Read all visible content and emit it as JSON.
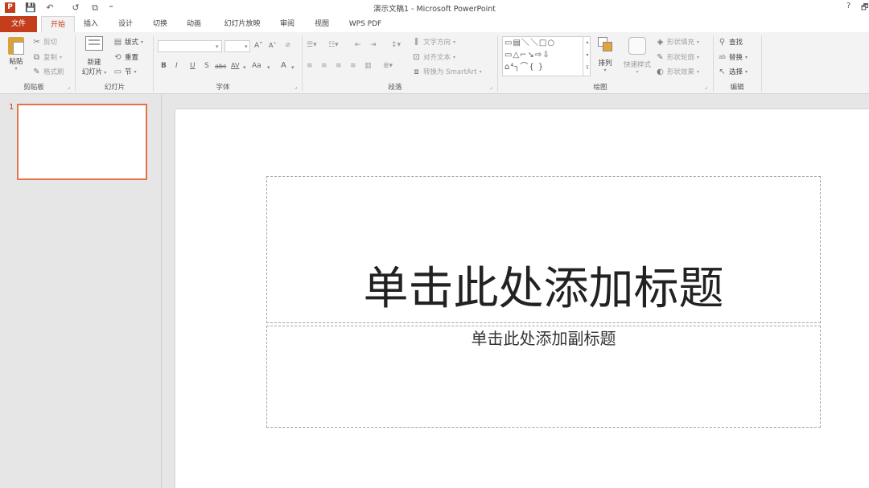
{
  "window": {
    "title": "演示文稿1 - Microsoft PowerPoint",
    "help": "?",
    "restore": "🗗"
  },
  "quick_access": {
    "app_icon": "P",
    "save_icon": "💾",
    "undo_icon": "↶",
    "redo_icon": "↺",
    "present_icon": "⧉",
    "customize_icon": "⁼"
  },
  "tabs": [
    "文件",
    "开始",
    "插入",
    "设计",
    "切换",
    "动画",
    "幻灯片放映",
    "审阅",
    "视图",
    "WPS PDF"
  ],
  "ribbon": {
    "clipboard": {
      "label": "剪贴板",
      "paste": "粘贴",
      "cut": "剪切",
      "copy": "复制",
      "format_painter": "格式刷"
    },
    "slides": {
      "label": "幻灯片",
      "new_slide_line1": "新建",
      "new_slide_line2": "幻灯片",
      "layout": "版式",
      "reset": "重置",
      "section": "节"
    },
    "font": {
      "label": "字体",
      "bold": "B",
      "italic": "I",
      "underline": "U",
      "strike": "S",
      "abc": "abc",
      "spacing": "AV",
      "case": "Aa",
      "color": "A",
      "grow": "A˄",
      "shrink": "A˅"
    },
    "paragraph": {
      "label": "段落",
      "text_direction": "文字方向",
      "align_text": "对齐文本",
      "smartart": "转换为 SmartArt"
    },
    "drawing": {
      "label": "绘图",
      "arrange": "排列",
      "quick_styles": "快速样式",
      "shape_fill": "形状填充",
      "shape_outline": "形状轮廓",
      "shape_effects": "形状效果",
      "shapes_row1": "▭▤＼＼□○",
      "shapes_row2": "▭△⌐↘⇨⇩",
      "shapes_row3": "⌂⁴╮⌒{ }"
    },
    "editing": {
      "label": "编辑",
      "find": "查找",
      "replace": "替换",
      "select": "选择"
    }
  },
  "thumbnails": [
    {
      "number": "1"
    }
  ],
  "slide": {
    "title_placeholder": "单击此处添加标题",
    "subtitle_placeholder": "单击此处添加副标题"
  },
  "colors": {
    "accent": "#c43e1c",
    "thumb_border": "#e2734a"
  }
}
